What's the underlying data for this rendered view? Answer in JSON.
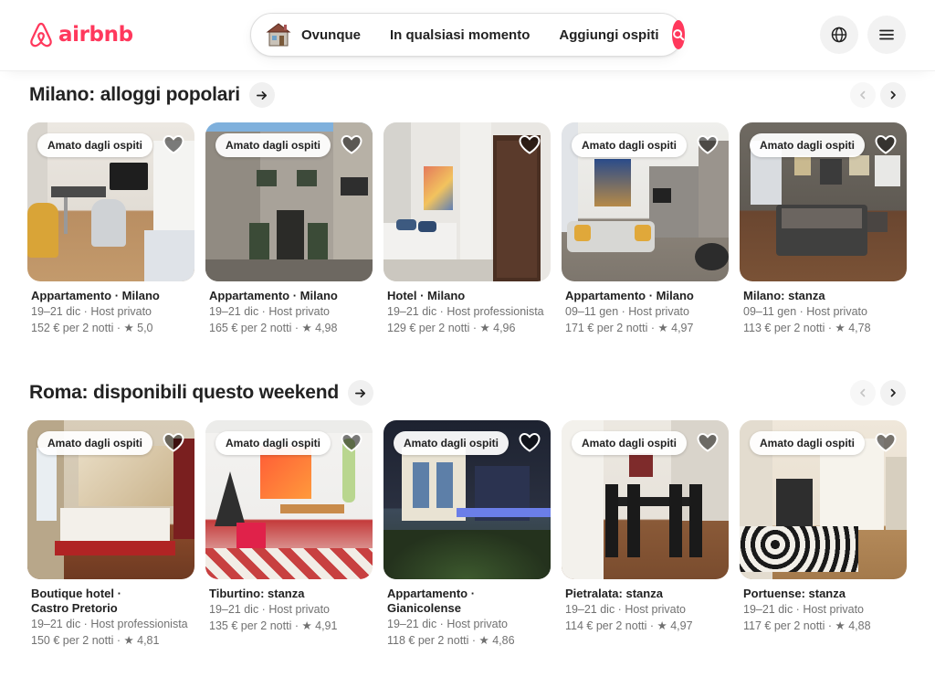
{
  "header": {
    "logo_text": "airbnb",
    "search": {
      "where": "Ovunque",
      "when": "In qualsiasi momento",
      "who": "Aggiungi ospiti"
    },
    "brand_color": "#ff385c"
  },
  "sections": [
    {
      "title": "Milano: alloggi popolari",
      "cards": [
        {
          "badge": "Amato dagli ospiti",
          "title": "Appartamento · Milano",
          "sub": "19–21 dic · Host privato",
          "price": "152 € per 2 notti · ",
          "rating": "★ 5,0"
        },
        {
          "badge": "Amato dagli ospiti",
          "title": "Appartamento · Milano",
          "sub": "19–21 dic · Host privato",
          "price": "165 € per 2 notti · ",
          "rating": "★ 4,98"
        },
        {
          "badge": "",
          "title": "Hotel · Milano",
          "sub": "19–21 dic · Host professionista",
          "price": "129 € per 2 notti · ",
          "rating": "★ 4,96"
        },
        {
          "badge": "Amato dagli ospiti",
          "title": "Appartamento · Milano",
          "sub": "09–11 gen · Host privato",
          "price": "171 € per 2 notti · ",
          "rating": "★ 4,97"
        },
        {
          "badge": "Amato dagli ospiti",
          "title": "Milano: stanza",
          "sub": "09–11 gen · Host privato",
          "price": "113 € per 2 notti · ",
          "rating": "★ 4,78"
        }
      ]
    },
    {
      "title": "Roma: disponibili questo weekend",
      "cards": [
        {
          "badge": "Amato dagli ospiti",
          "title": "Boutique hotel ·",
          "title2": "Castro Pretorio",
          "sub": "19–21 dic · Host professionista",
          "price": "150 € per 2 notti · ",
          "rating": "★ 4,81"
        },
        {
          "badge": "Amato dagli ospiti",
          "title": "Tiburtino: stanza",
          "title2": "",
          "sub": "19–21 dic · Host privato",
          "price": "135 € per 2 notti · ",
          "rating": "★ 4,91"
        },
        {
          "badge": "Amato dagli ospiti",
          "title": "Appartamento ·",
          "title2": "Gianicolense",
          "sub": "19–21 dic · Host privato",
          "price": "118 € per 2 notti · ",
          "rating": "★ 4,86"
        },
        {
          "badge": "Amato dagli ospiti",
          "title": "Pietralata: stanza",
          "title2": "",
          "sub": "19–21 dic · Host privato",
          "price": "114 € per 2 notti · ",
          "rating": "★ 4,97"
        },
        {
          "badge": "Amato dagli ospiti",
          "title": "Portuense: stanza",
          "title2": "",
          "sub": "19–21 dic · Host privato",
          "price": "117 € per 2 notti · ",
          "rating": "★ 4,88"
        }
      ]
    }
  ],
  "icons": {
    "logo": "airbnb-logo-icon",
    "where": "house-icon",
    "search": "search-icon",
    "language": "globe-icon",
    "menu": "hamburger-menu-icon",
    "wishlist": "heart-icon",
    "show_all": "arrow-right-icon",
    "prev": "chevron-left-icon",
    "next": "chevron-right-icon"
  }
}
